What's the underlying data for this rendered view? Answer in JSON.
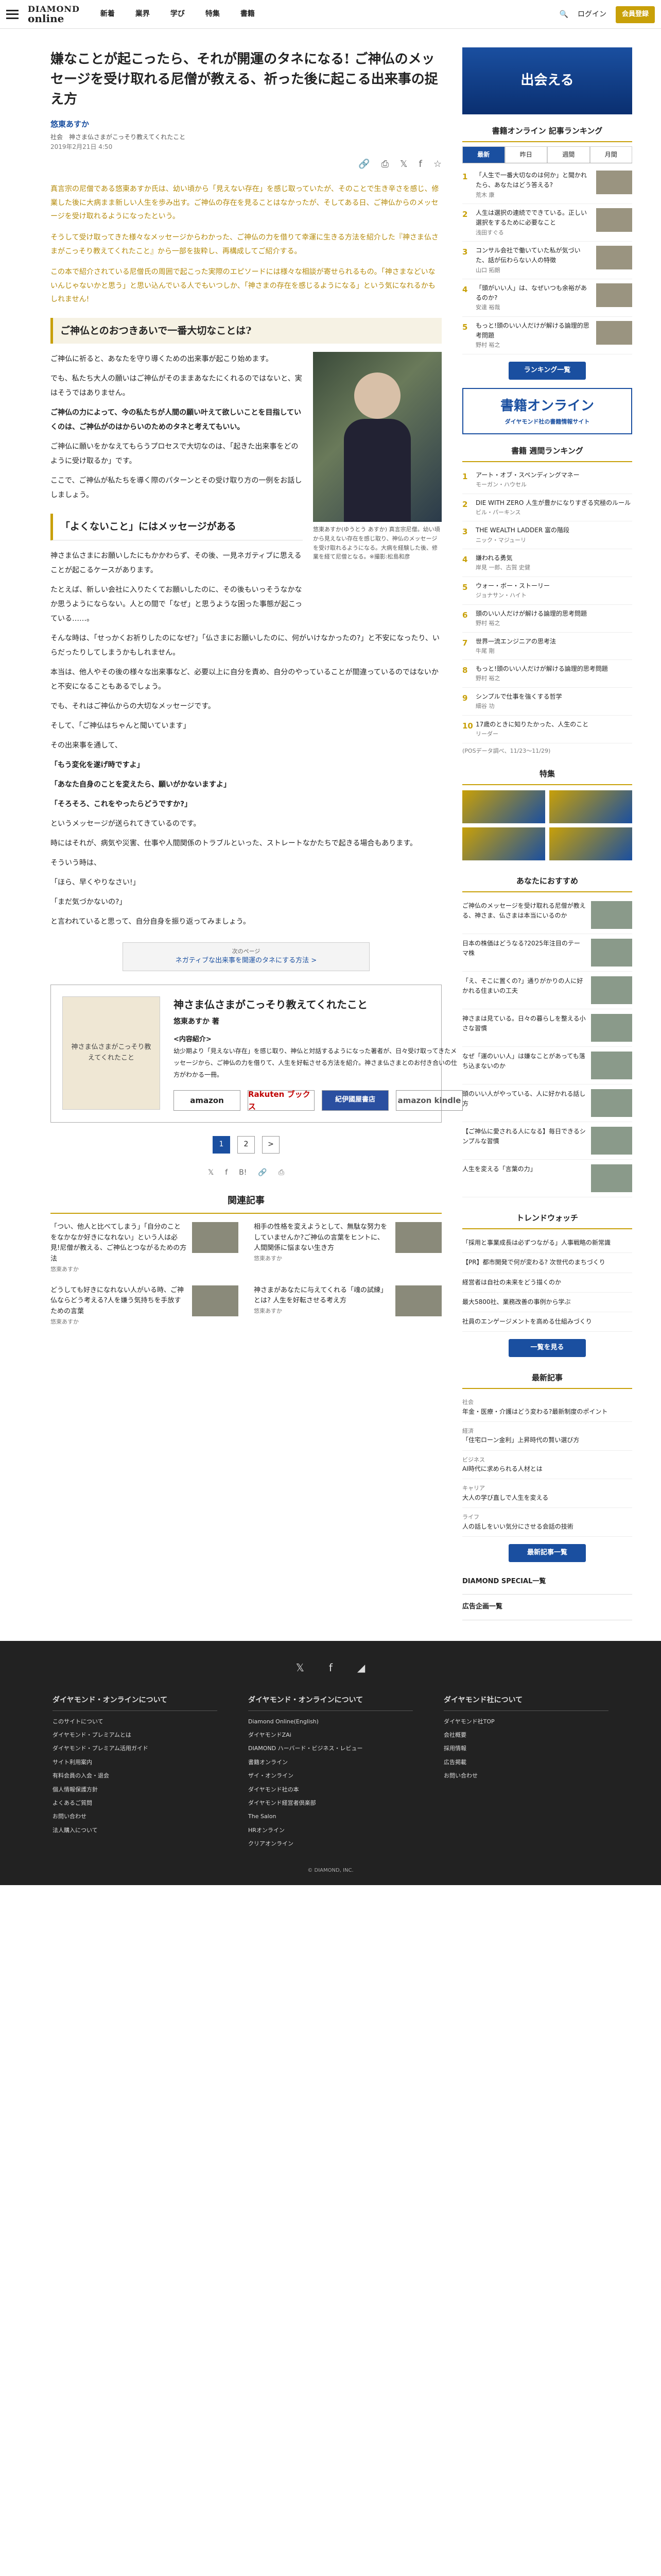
{
  "header": {
    "logo_top": "DIAMOND",
    "logo_bottom": "online",
    "nav": [
      "新着",
      "業界",
      "学び",
      "特集",
      "書籍"
    ],
    "login": "ログイン",
    "register": "会員登録"
  },
  "article": {
    "title": "嫌なことが起こったら、それが開運のタネになる! ご神仏のメッセージを受け取れる尼僧が教える、祈った後に起こる出来事の捉え方",
    "author": "悠東あすか",
    "crumb": "社会　神さま仏さまがこっそり教えてくれたこと",
    "date": "2019年2月21日 4:50",
    "lead1": "真言宗の尼僧である悠東あすか氏は、幼い頃から「見えない存在」を感じ取っていたが、そのことで生き辛さを感じ、修業した後に大病まま新しい人生を歩み出す。ご神仏の存在を見ることはなかったが、そしてある日、ご神仏からのメッセージを受け取れるようになったという。",
    "lead2": "そうして受け取ってきた様々なメッセージからわかった、ご神仏の力を借りて幸運に生きる方法を紹介した『神さま仏さまがこっそり教えてくれたこと』から一部を抜粋し、再構成してご紹介する。",
    "lead3": "この本で紹介されている尼僧氏の周囲で起こった実際のエピソードには様々な相談が寄せられるもの。「神さまなどいないんじゃないかと思う」と思い込んでいる人でもいつしか、「神さまの存在を感じるようになる」という気になれるかもしれません!",
    "s1": "ご神仏とのおつきあいで一番大切なことは?",
    "p1": "ご神仏に祈ると、あなたを守り導くための出来事が起こり始めます。",
    "p2": "でも、私たち大人の願いはご神仏がそのままあなたにくれるのではないと、実はそうではありません。",
    "p3b": "ご神仏の力によって、今の私たちが人間の願い叶えて欲しいことを目指していくのは、ご神仏がのはからいのためのタネと考えてもいい。",
    "p4": "ご神仏に願いをかなえてもらうプロセスで大切なのは、「起きた出来事をどのように受け取るか」です。",
    "p5": "ここで、ご神仏が私たちを導く際のパターンとその受け取り方の一例をお話ししましょう。",
    "s2": "「よくないこと」にはメッセージがある",
    "p6": "神さま仏さまにお願いしたにもかかわらず、その後、一見ネガティブに思えることが起こるケースがあります。",
    "p7": "たとえば、新しい会社に入りたくてお願いしたのに、その後もいっそうなかなか思うようにならない。人との間で「なぜ」と思うような困った事態が起こっている……。",
    "p8": "そんな時は、「せっかくお祈りしたのになぜ?」「仏さまにお願いしたのに、何がいけなかったの?」と不安になったり、いらだったりしてしまうかもしれません。",
    "p9": "本当は、他人やその後の様々な出来事など、必要以上に自分を責め、自分のやっていることが間違っているのではないかと不安になることもあるでしょう。",
    "p10": "でも、それはご神仏からの大切なメッセージです。",
    "p11": "そして、「ご神仏はちゃんと聞いています」",
    "p12": "その出来事を通して、",
    "q1": "「もう変化を遂げ時ですよ」",
    "q2": "「あなた自身のことを変えたら、願いがかないますよ」",
    "q3": "「そろそろ、これをやったらどうですか?」",
    "p13": "というメッセージが送られてきているのです。",
    "p14": "時にはそれが、病気や災害、仕事や人間関係のトラブルといった、ストレートなかたちで起きる場合もあります。",
    "p15": "そういう時は、",
    "p16": "「ほら、早くやりなさい!」",
    "p17": "「まだ気づかないの?」",
    "p18": "と言われていると思って、自分自身を振り返ってみましょう。",
    "photo_caption": "悠東あすか(ゆうとう あすか) 真言宗尼僧。幼い頃から見えない存在を感じ取り、神仏のメッセージを受け取れるようになる。大病を経験した後、修業を経て尼僧となる。※撮影:松島和彦",
    "next_label": "次のページ",
    "next_link": "ネガティブな出来事を開運のタネにする方法 >"
  },
  "book": {
    "title": "神さま仏さまがこっそり教えてくれたこと",
    "by": "悠東あすか 著",
    "contents_label": "<内容紹介>",
    "desc": "幼少期より「見えない存在」を感じ取り、神仏と対話するようになった著者が、日々受け取ってきたメッセージから、ご神仏の力を借りて、人生を好転させる方法を紹介。神さま仏さまとのお付き合いの仕方がわかる一冊。",
    "cover": "神さま仏さまがこっそり教えてくれたこと",
    "shops": [
      "amazon",
      "Rakuten ブックス",
      "紀伊國屋書店",
      "amazon kindle"
    ]
  },
  "pager": {
    "pages": [
      "1",
      "2"
    ],
    "next": ">"
  },
  "related": {
    "heading": "関連記事",
    "items": [
      {
        "title": "「つい、他人と比べてしまう」「自分のことをなかなか好きになれない」という人は必見!尼僧が教える、ご神仏とつながるための方法",
        "author": "悠東あすか"
      },
      {
        "title": "相手の性格を変えようとして、無駄な努力をしていませんか?ご神仏の言葉をヒントに、人間関係に悩まない生き方",
        "author": "悠東あすか"
      },
      {
        "title": "どうしても好きになれない人がいる時、ご神仏ならどう考える?人を嫌う気持ちを手放すための言葉",
        "author": "悠東あすか"
      },
      {
        "title": "神さまがあなたに与えてくれる「魂の試練」とは? 人生を好転させる考え方",
        "author": "悠東あすか"
      }
    ]
  },
  "side": {
    "banner": "出会える",
    "ranking_title": "書籍オンライン 記事ランキング",
    "tabs": [
      "最新",
      "昨日",
      "週間",
      "月間"
    ],
    "rank": [
      {
        "t": "「人生で一番大切なのは何か」と聞かれたら、あなたはどう答える?",
        "a": "荒木 康"
      },
      {
        "t": "人生は選択の連続でできている。正しい選択をするために必要なこと",
        "a": "浅田すぐる"
      },
      {
        "t": "コンサル会社で働いていた私が気づいた、話が伝わらない人の特徴",
        "a": "山口 拓朗"
      },
      {
        "t": "「頭がいい人」は、なぜいつも余裕があるのか?",
        "a": "安達 裕哉"
      },
      {
        "t": "もっと!頭のいい人だけが解ける論理的思考問題",
        "a": "野村 裕之"
      }
    ],
    "rank_more": "ランキング一覧",
    "ban2_big": "書籍オンライン",
    "ban2_sm": "ダイヤモンド社の書籍情報サイト",
    "book_rank_title": "書籍 週間ランキング",
    "book_rank": [
      {
        "t": "アート・オブ・スペンディングマネー",
        "a": "モーガン・ハウセル"
      },
      {
        "t": "DIE WITH ZERO 人生が豊かになりすぎる究極のルール",
        "a": "ビル・パーキンス"
      },
      {
        "t": "THE WEALTH LADDER 富の階段",
        "a": "ニック・マジューリ"
      },
      {
        "t": "嫌われる勇気",
        "a": "岸見 一郎、古賀 史健"
      },
      {
        "t": "ウォー・ボー・ストーリー",
        "a": "ジョナサン・ハイト"
      },
      {
        "t": "頭のいい人だけが解ける論理的思考問題",
        "a": "野村 裕之"
      },
      {
        "t": "世界一流エンジニアの思考法",
        "a": "牛尾 剛"
      },
      {
        "t": "もっと!頭のいい人だけが解ける論理的思考問題",
        "a": "野村 裕之"
      },
      {
        "t": "シンプルで仕事を強くする哲学",
        "a": "細谷 功"
      },
      {
        "t": "17歳のときに知りたかった、人生のこと",
        "a": "リーダー"
      }
    ],
    "pos_note": "(POSデータ調べ、11/23〜11/29)",
    "feature_title": "特集",
    "rec_title": "あなたにおすすめ",
    "rec": [
      {
        "t": "ご神仏のメッセージを受け取れる尼僧が教える、神さま、仏さまは本当にいるのか"
      },
      {
        "t": "日本の株価はどうなる?2025年注目のテーマ株"
      },
      {
        "t": "「え、そこに置くの?」通りがかりの人に好かれる住まいの工夫"
      },
      {
        "t": "神さまは見ている。日々の暮らしを整える小さな習慣"
      },
      {
        "t": "なぜ「運のいい人」は嫌なことがあっても落ち込まないのか"
      },
      {
        "t": "頭のいい人がやっている、人に好かれる話し方"
      },
      {
        "t": "【ご神仏に愛される人になる】毎日できるシンプルな習慣"
      },
      {
        "t": "人生を変える「言葉の力」"
      }
    ],
    "trend_title": "トレンドウォッチ",
    "trend": [
      "「採用と事業成長は必ずつながる」人事戦略の新常識",
      "【PR】都市開発で何が変わる? 次世代のまちづくり",
      "経営者は自社の未来をどう描くのか",
      "最大5800社、業務改善の事例から学ぶ",
      "社員のエンゲージメントを高める仕組みづくり"
    ],
    "trend_more": "一覧を見る",
    "latest_title": "最新記事",
    "latest": [
      {
        "c": "社会",
        "t": "年金・医療・介護はどう変わる?最新制度のポイント"
      },
      {
        "c": "経済",
        "t": "「住宅ローン金利」上昇時代の賢い選び方"
      },
      {
        "c": "ビジネス",
        "t": "AI時代に求められる人材とは"
      },
      {
        "c": "キャリア",
        "t": "大人の学び直しで人生を変える"
      },
      {
        "c": "ライフ",
        "t": "人の話しをいい気分にさせる会話の技術"
      }
    ],
    "latest_more": "最新記事一覧",
    "special": "DIAMOND SPECIAL一覧",
    "ads": "広告企画一覧"
  },
  "footer": {
    "cols": [
      {
        "h": "ダイヤモンド・オンラインについて",
        "items": [
          "このサイトについて",
          "ダイヤモンド・プレミアムとは",
          "ダイヤモンド・プレミアム活用ガイド",
          "サイト利用案内",
          "有料会員の入会・退会",
          "個人情報保護方針",
          "よくあるご質問",
          "お問い合わせ",
          "法人購入について"
        ]
      },
      {
        "h": "ダイヤモンド・オンラインについて",
        "items": [
          "Diamond Online(English)",
          "ダイヤモンドZAi",
          "DIAMOND ハーバード・ビジネス・レビュー",
          "書籍オンライン",
          "ザイ・オンライン",
          "ダイヤモンド社の本",
          "ダイヤモンド経営者倶楽部",
          "The Salon",
          "HRオンライン",
          "クリアオンライン"
        ]
      },
      {
        "h": "ダイヤモンド社について",
        "items": [
          "ダイヤモンド社TOP",
          "会社概要",
          "採用情報",
          "広告掲載",
          "お問い合わせ"
        ]
      }
    ],
    "copy": "© DIAMOND, INC."
  }
}
